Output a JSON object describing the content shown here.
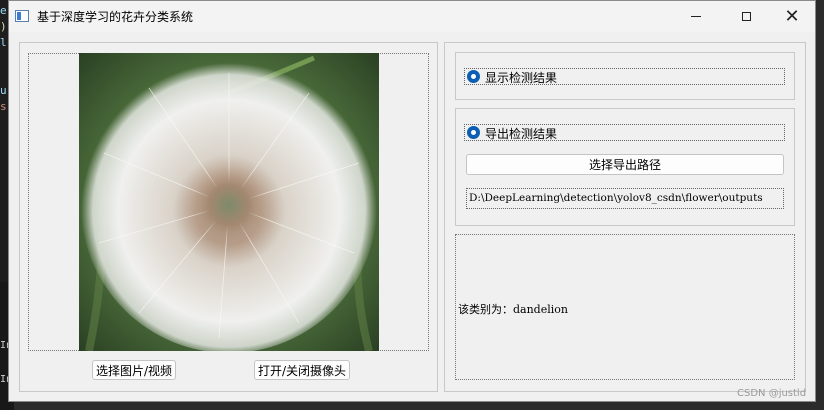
{
  "window": {
    "title": "基于深度学习的花卉分类系统",
    "controls": {
      "minimize_icon": "minimize-icon",
      "maximize_icon": "maximize-icon",
      "close_icon": "close-icon",
      "close_glyph": "✕"
    }
  },
  "background_code": {
    "lines": [
      "e",
      ")",
      "l",
      "u",
      "s"
    ],
    "terminal": [
      "In",
      "In"
    ]
  },
  "left_panel": {
    "image_alt": "dandelion",
    "select_image_button": "选择图片/视频",
    "camera_button": "打开/关闭摄像头"
  },
  "right_panel": {
    "show_results_radio": {
      "label": "显示检测结果",
      "checked": true
    },
    "export_results_radio": {
      "label": "导出检测结果",
      "checked": true
    },
    "select_export_path_button": "选择导出路径",
    "export_path": "D:\\DeepLearning\\detection\\yolov8_csdn\\flower\\outputs",
    "result_label": "该类别为：",
    "result_value": "dandelion"
  },
  "watermark": "CSDN @justld",
  "colors": {
    "accent": "#0a5fb4",
    "window_bg": "#f0f0f0"
  }
}
